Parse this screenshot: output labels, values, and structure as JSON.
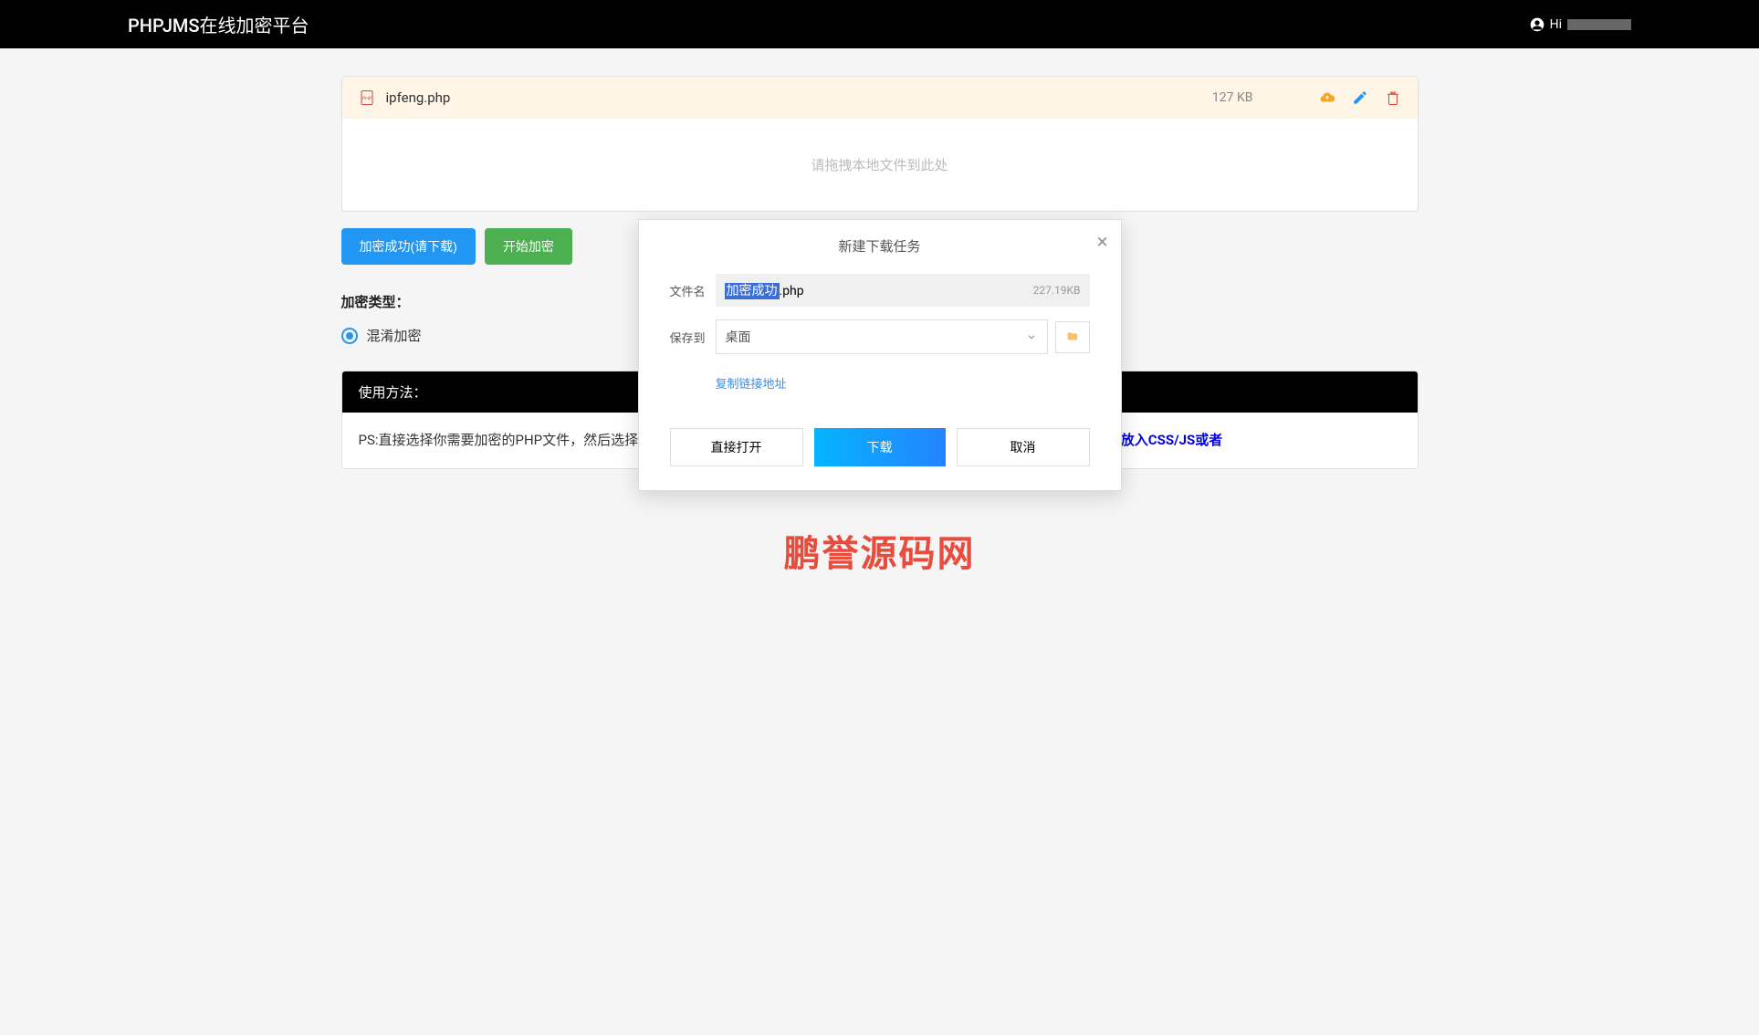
{
  "header": {
    "title": "PHPJMS在线加密平台",
    "user_greeting": "Hi"
  },
  "file": {
    "name": "ipfeng.php",
    "size": "127 KB"
  },
  "dropzone": {
    "text": "请拖拽本地文件到此处"
  },
  "buttons": {
    "success_download": "加密成功(请下载)",
    "start": "开始加密"
  },
  "encryption": {
    "type_label": "加密类型：",
    "option": "混淆加密"
  },
  "usage": {
    "title": "使用方法：",
    "body_prefix": "PS:直接选择你需要加密的PHP文件，然后选择",
    "highlight_red": "经加密过的文件，以此来进一步提高代码的安全性，但是切记不要在PHP文件中放入CSS/JS或者"
  },
  "watermark": "鹏誉源码网",
  "modal": {
    "title": "新建下载任务",
    "filename_label": "文件名",
    "filename_selected": "加密成功",
    "filename_ext": ".php",
    "filesize": "227.19KB",
    "save_label": "保存到",
    "save_location": "桌面",
    "copy_link": "复制链接地址",
    "open": "直接打开",
    "download": "下载",
    "cancel": "取消"
  }
}
